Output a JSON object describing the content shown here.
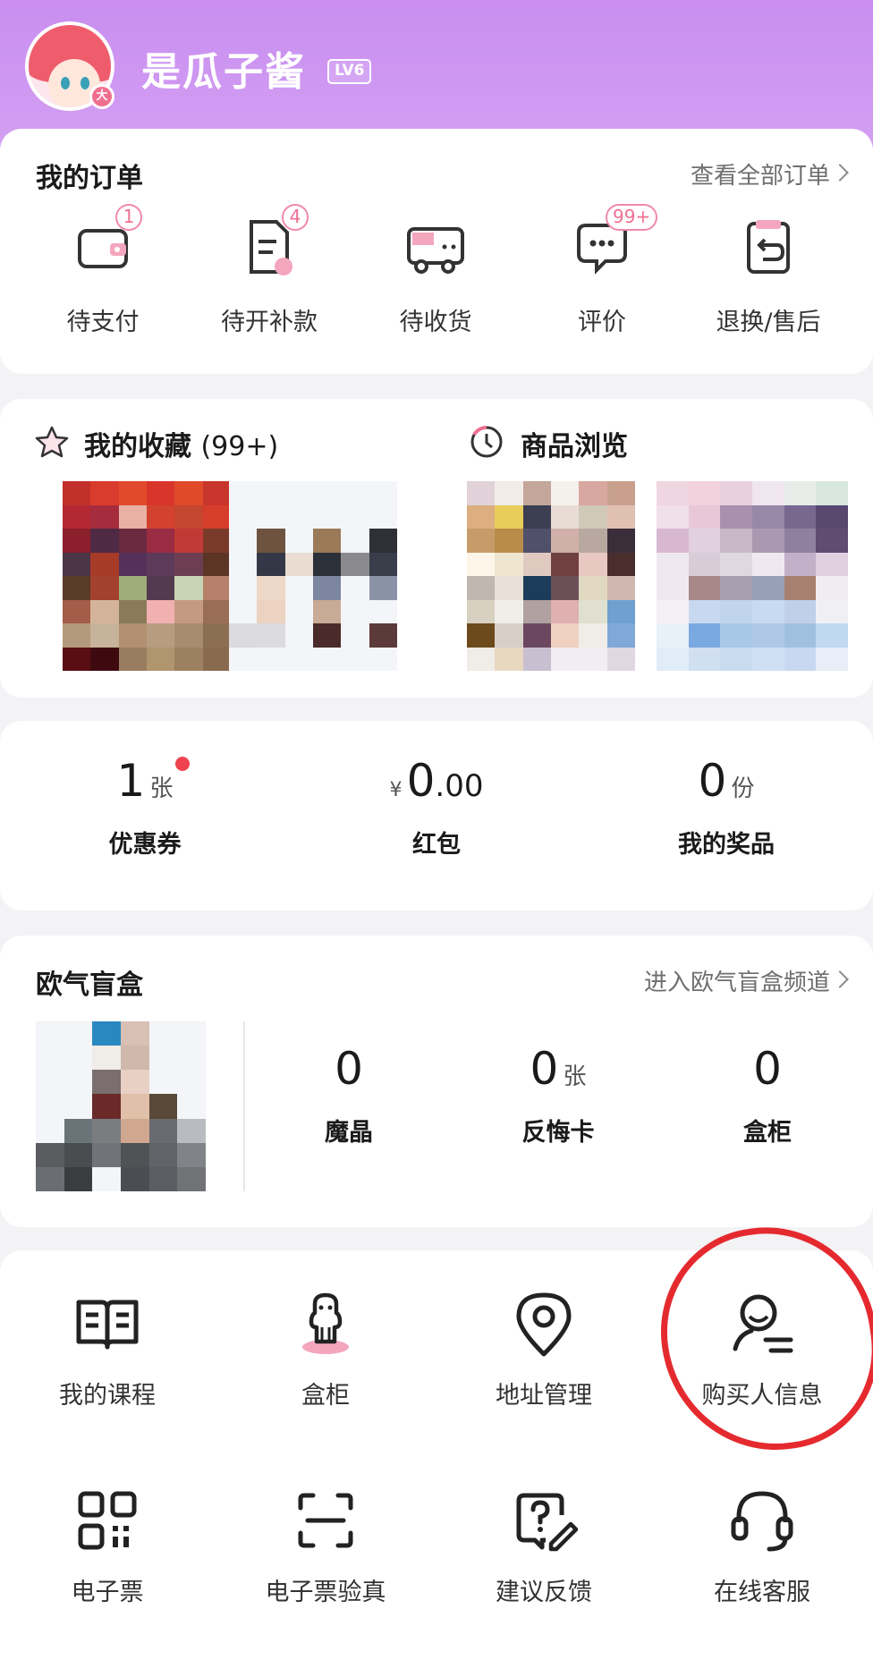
{
  "profile": {
    "name": "是瓜子酱",
    "level": "LV6",
    "badge": "大"
  },
  "orders": {
    "title": "我的订单",
    "view_all": "查看全部订单",
    "items": [
      {
        "label": "待支付",
        "badge": "1",
        "icon": "wallet-icon"
      },
      {
        "label": "待开补款",
        "badge": "4",
        "icon": "document-icon"
      },
      {
        "label": "待收货",
        "badge": "",
        "icon": "truck-icon"
      },
      {
        "label": "评价",
        "badge": "99+",
        "icon": "chat-icon"
      },
      {
        "label": "退换/售后",
        "badge": "",
        "icon": "return-icon"
      }
    ]
  },
  "favorites": {
    "title": "我的收藏",
    "count": "(99+)",
    "icon": "star-icon"
  },
  "history": {
    "title": "商品浏览",
    "icon": "clock-icon"
  },
  "wallet": {
    "coupons": {
      "value": "1",
      "unit": "张",
      "label": "优惠券"
    },
    "redpacket": {
      "currency": "¥",
      "value": "0",
      "decimal": ".00",
      "label": "红包"
    },
    "prizes": {
      "value": "0",
      "unit": "份",
      "label": "我的奖品"
    }
  },
  "blindbox": {
    "title": "欧气盲盒",
    "link": "进入欧气盲盒频道",
    "stats": [
      {
        "value": "0",
        "unit": "",
        "label": "魔晶"
      },
      {
        "value": "0",
        "unit": "张",
        "label": "反悔卡"
      },
      {
        "value": "0",
        "unit": "",
        "label": "盒柜"
      }
    ]
  },
  "services": [
    {
      "label": "我的课程",
      "icon": "book-icon"
    },
    {
      "label": "盒柜",
      "icon": "figure-icon"
    },
    {
      "label": "地址管理",
      "icon": "location-pin-icon"
    },
    {
      "label": "购买人信息",
      "icon": "user-info-icon"
    },
    {
      "label": "电子票",
      "icon": "qr-code-icon"
    },
    {
      "label": "电子票验真",
      "icon": "scan-icon"
    },
    {
      "label": "建议反馈",
      "icon": "feedback-icon"
    },
    {
      "label": "在线客服",
      "icon": "headset-icon"
    }
  ],
  "colors": {
    "header": "#c98ef0",
    "accent_pink": "#ef6f93",
    "annotation_red": "#e52a2f"
  }
}
